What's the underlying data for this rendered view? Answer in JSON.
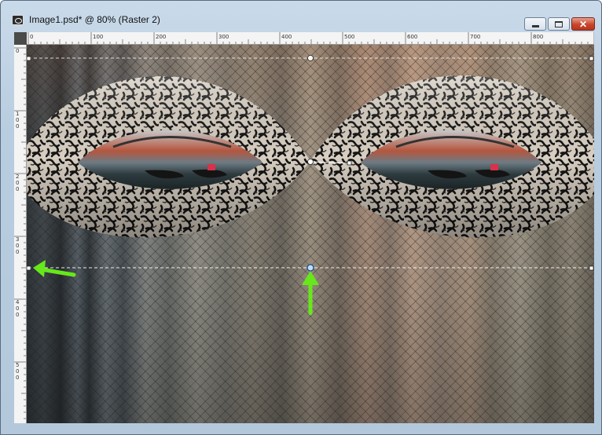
{
  "window": {
    "title": "Image1.psd* @  80% (Raster 2)",
    "icon": "camera-app-icon",
    "buttons": {
      "minimize": "minimize-icon",
      "maximize": "maximize-icon",
      "close": "close-icon"
    }
  },
  "ruler": {
    "horizontal_labels": [
      "0",
      "100",
      "200",
      "300",
      "400",
      "500",
      "600",
      "700",
      "800"
    ],
    "vertical_labels": [
      "0",
      "100",
      "200",
      "300",
      "400",
      "500"
    ]
  },
  "canvas": {
    "zoom": "80%",
    "layer": "Raster 2",
    "content": "twin-lens-mask-with-venice-gondola-scenes",
    "annotations": [
      "green-arrow-left",
      "green-arrow-up"
    ],
    "colors": {
      "arrow": "#66e81a",
      "guide": "#ffffff",
      "mask_light": "#e6ded2",
      "mask_dark": "#141414"
    }
  }
}
